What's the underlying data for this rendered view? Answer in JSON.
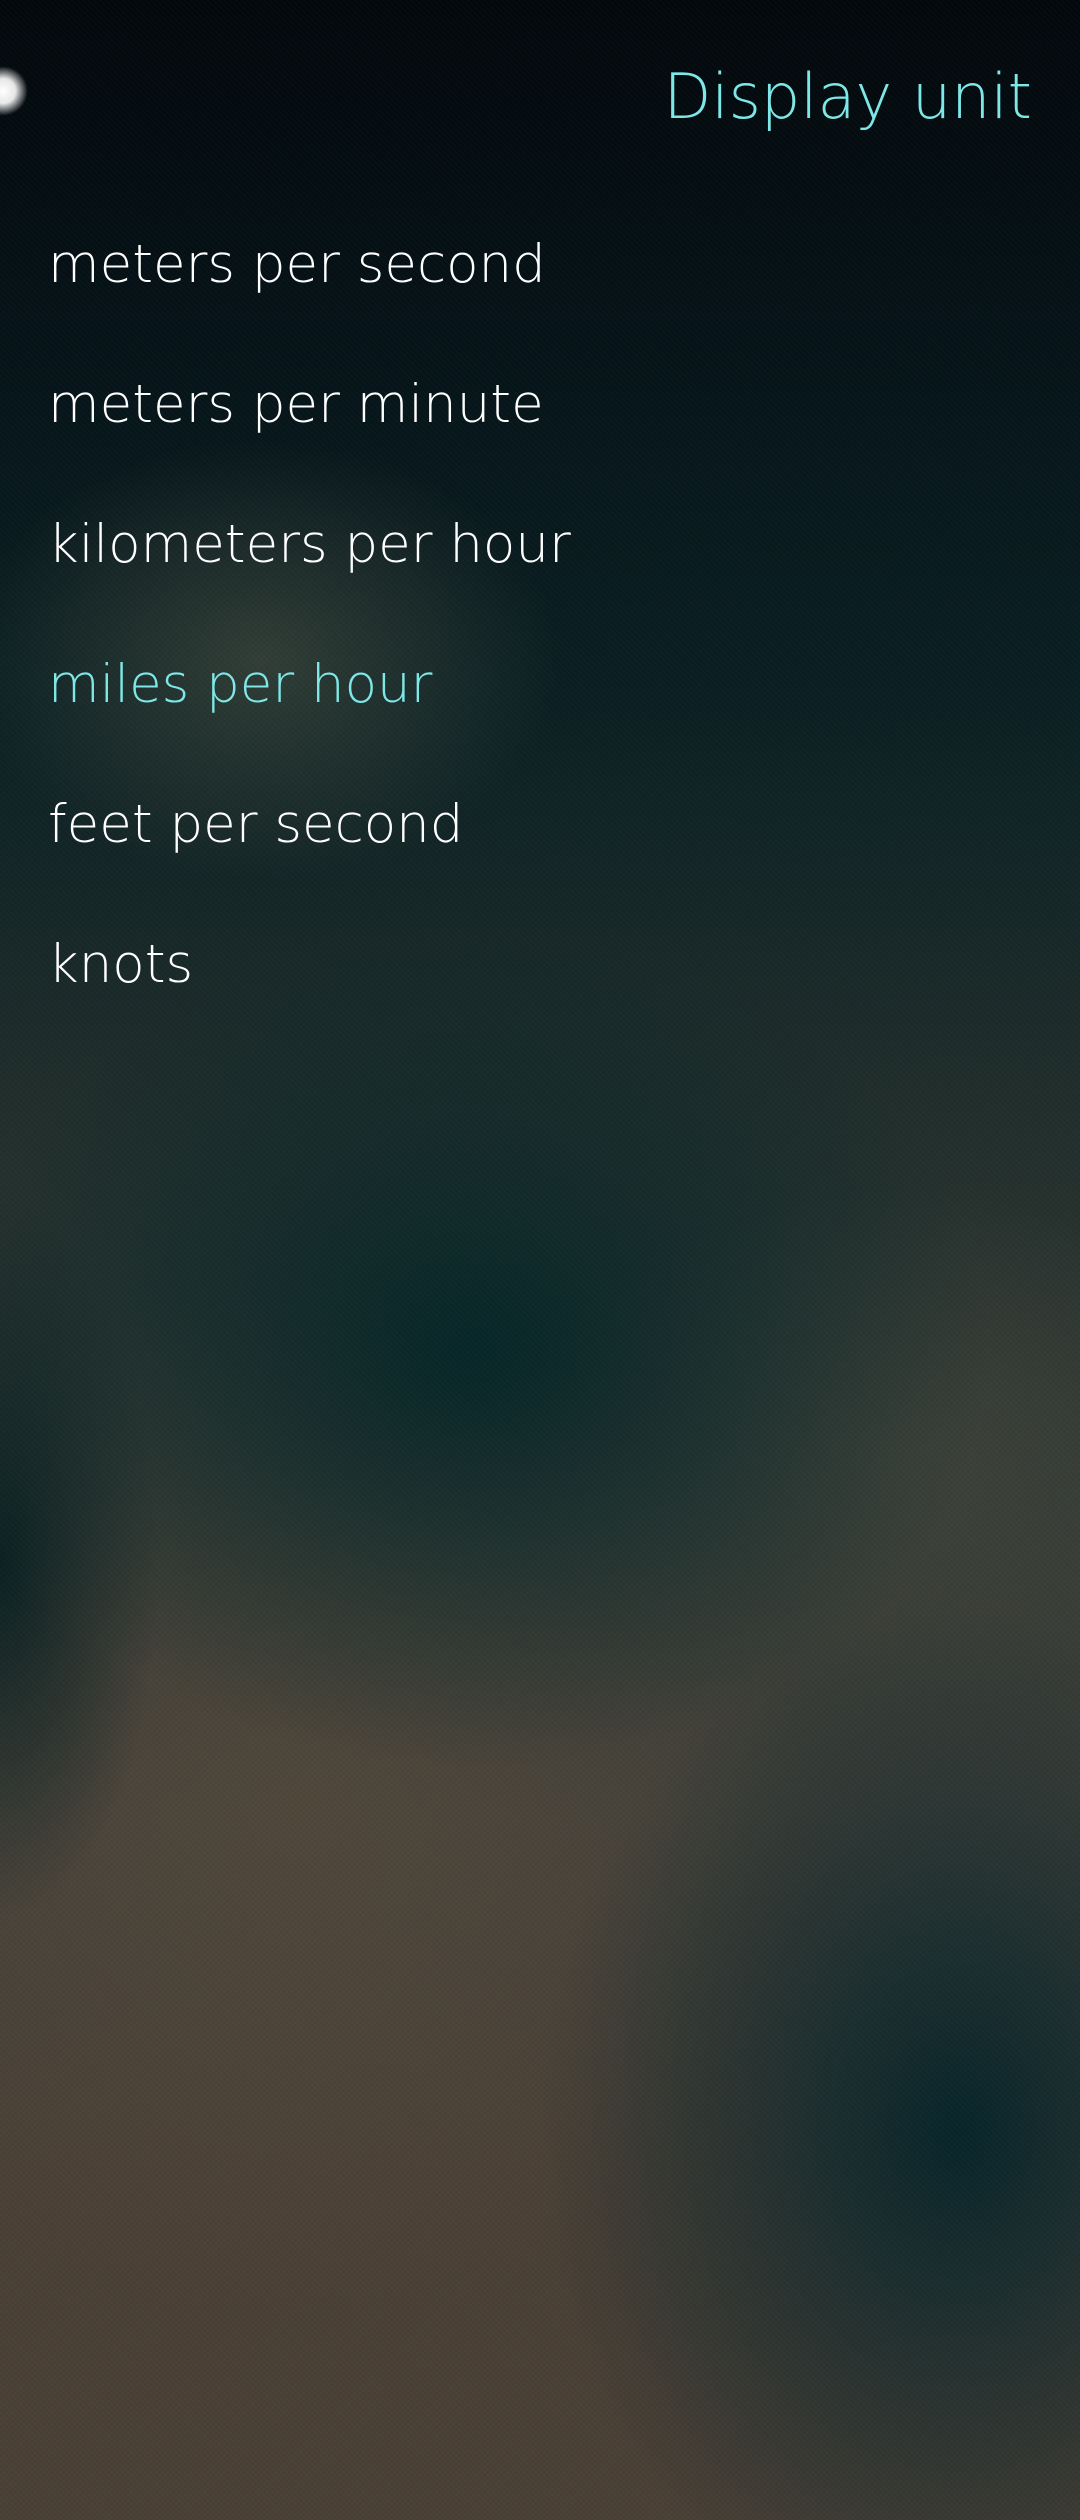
{
  "header": {
    "title": "Display unit"
  },
  "options": [
    {
      "label": "meters per second",
      "selected": false
    },
    {
      "label": "meters per minute",
      "selected": false
    },
    {
      "label": "kilometers per hour",
      "selected": false
    },
    {
      "label": "miles per hour",
      "selected": true
    },
    {
      "label": "feet per second",
      "selected": false
    },
    {
      "label": "knots",
      "selected": false
    }
  ],
  "colors": {
    "accent": "#7ee7e7",
    "text": "#ffffff"
  }
}
